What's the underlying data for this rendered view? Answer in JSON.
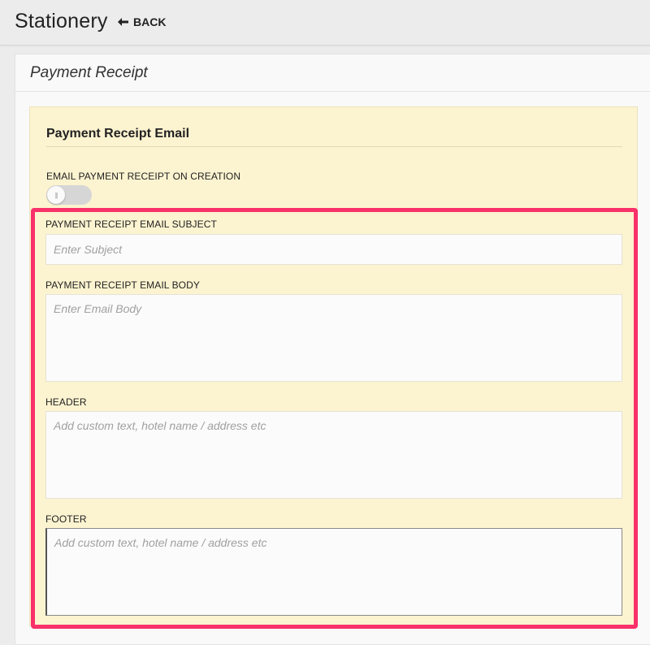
{
  "header": {
    "title": "Stationery",
    "back_label": "BACK"
  },
  "card": {
    "title": "Payment Receipt"
  },
  "section": {
    "title": "Payment Receipt Email",
    "toggle_label": "EMAIL PAYMENT RECEIPT ON CREATION",
    "toggle_on": false
  },
  "fields": {
    "subject": {
      "label": "PAYMENT RECEIPT EMAIL SUBJECT",
      "placeholder": "Enter Subject",
      "value": ""
    },
    "body": {
      "label": "PAYMENT RECEIPT EMAIL BODY",
      "placeholder": "Enter Email Body",
      "value": ""
    },
    "header": {
      "label": "HEADER",
      "placeholder": "Add custom text, hotel name / address etc",
      "value": ""
    },
    "footer": {
      "label": "FOOTER",
      "placeholder": "Add custom text, hotel name / address etc",
      "value": ""
    }
  },
  "colors": {
    "highlight": "#f8316a",
    "panel_bg": "#fcf3d0"
  }
}
